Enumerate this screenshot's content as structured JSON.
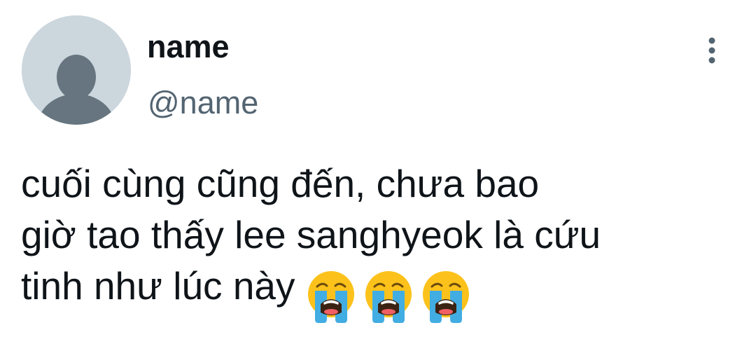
{
  "tweet": {
    "author": {
      "display_name": "name",
      "handle": "@name",
      "avatar_icon": "default-profile-icon"
    },
    "more_icon": "more-vertical-icon",
    "text_lines": [
      "cuối cùng cũng đến, chưa bao",
      "giờ tao thấy lee sanghyeok là cứu",
      "tinh như lúc này"
    ],
    "emojis": [
      "loudly-crying-face-emoji",
      "loudly-crying-face-emoji",
      "loudly-crying-face-emoji"
    ],
    "colors": {
      "text": "#0f1419",
      "secondary_text": "#536471",
      "avatar_bg": "#ccd6dd",
      "avatar_figure": "#66757f",
      "emoji_face": "#fcc21b",
      "emoji_tears": "#42ade2"
    }
  }
}
